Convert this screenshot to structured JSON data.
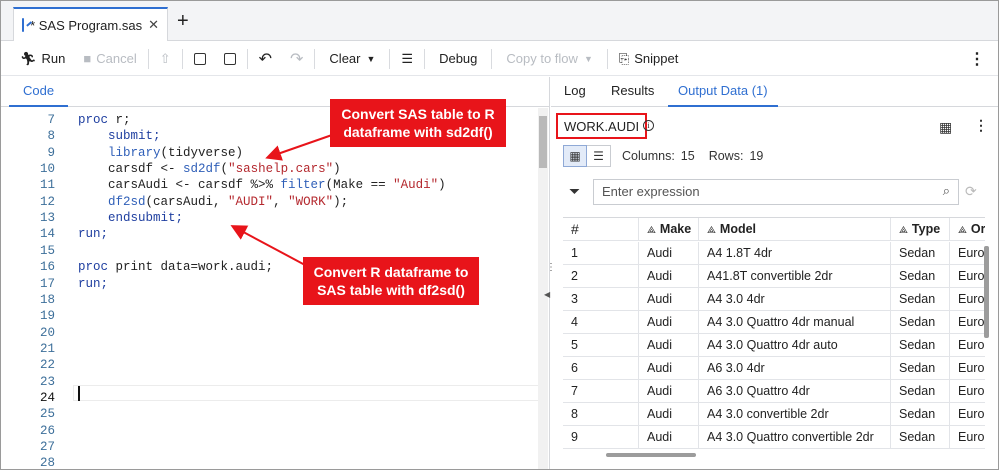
{
  "tab": {
    "title": "* SAS Program.sas",
    "close": "✕",
    "new": "+"
  },
  "toolbar": {
    "run": "Run",
    "cancel": "Cancel",
    "clear": "Clear",
    "debug": "Debug",
    "copy_to_flow": "Copy to flow",
    "snippet": "Snippet",
    "more": "⋮"
  },
  "left": {
    "code_tab": "Code"
  },
  "code": {
    "lines": [
      {
        "n": "7",
        "t": "proc r;"
      },
      {
        "n": "8",
        "t": "    submit;"
      },
      {
        "n": "9",
        "t": "    library(tidyverse)"
      },
      {
        "n": "10",
        "t": "    carsdf <- sd2df(\"sashelp.cars\")"
      },
      {
        "n": "11",
        "t": "    carsAudi <- carsdf %>% filter(Make == \"Audi\")"
      },
      {
        "n": "12",
        "t": "    df2sd(carsAudi, \"AUDI\", \"WORK\");"
      },
      {
        "n": "13",
        "t": "    endsubmit;"
      },
      {
        "n": "14",
        "t": "run;"
      },
      {
        "n": "15",
        "t": ""
      },
      {
        "n": "16",
        "t": "proc print data=work.audi;"
      },
      {
        "n": "17",
        "t": "run;"
      },
      {
        "n": "18",
        "t": ""
      },
      {
        "n": "19",
        "t": ""
      },
      {
        "n": "20",
        "t": ""
      },
      {
        "n": "21",
        "t": ""
      },
      {
        "n": "22",
        "t": ""
      },
      {
        "n": "23",
        "t": ""
      },
      {
        "n": "24",
        "t": ""
      },
      {
        "n": "25",
        "t": ""
      },
      {
        "n": "26",
        "t": ""
      },
      {
        "n": "27",
        "t": ""
      },
      {
        "n": "28",
        "t": ""
      }
    ]
  },
  "annotations": {
    "a1_line1": "Convert SAS table to R",
    "a1_line2": "dataframe with sd2df()",
    "a2_line1": "Convert R dataframe to",
    "a2_line2": "SAS table with df2sd()"
  },
  "right": {
    "tabs": [
      "Log",
      "Results",
      "Output Data (1)"
    ],
    "table_name": "WORK.AUDI",
    "columns_label": "Columns:",
    "columns_value": "15",
    "rows_label": "Rows:",
    "rows_value": "19",
    "filter_placeholder": "Enter expression"
  },
  "grid": {
    "headers": [
      "#",
      "Make",
      "Model",
      "Type",
      "Orig"
    ],
    "rows": [
      [
        "1",
        "Audi",
        "A4 1.8T 4dr",
        "Sedan",
        "Euro"
      ],
      [
        "2",
        "Audi",
        "A41.8T convertible 2dr",
        "Sedan",
        "Euro"
      ],
      [
        "3",
        "Audi",
        "A4 3.0 4dr",
        "Sedan",
        "Euro"
      ],
      [
        "4",
        "Audi",
        "A4 3.0 Quattro 4dr manual",
        "Sedan",
        "Euro"
      ],
      [
        "5",
        "Audi",
        "A4 3.0 Quattro 4dr auto",
        "Sedan",
        "Euro"
      ],
      [
        "6",
        "Audi",
        "A6 3.0 4dr",
        "Sedan",
        "Euro"
      ],
      [
        "7",
        "Audi",
        "A6 3.0 Quattro 4dr",
        "Sedan",
        "Euro"
      ],
      [
        "8",
        "Audi",
        "A4 3.0 convertible 2dr",
        "Sedan",
        "Euro"
      ],
      [
        "9",
        "Audi",
        "A4 3.0 Quattro convertible 2dr",
        "Sedan",
        "Euro"
      ]
    ]
  },
  "colors": {
    "accent": "#2f6fd1",
    "callout": "#e8141a"
  }
}
